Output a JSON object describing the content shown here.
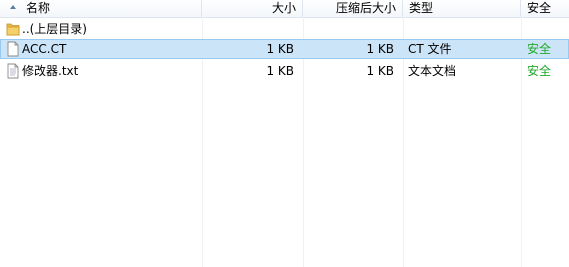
{
  "columns": {
    "name": "名称",
    "size": "大小",
    "compressed_size": "压缩后大小",
    "type": "类型",
    "security": "安全"
  },
  "rows": [
    {
      "name": "..(上层目录)",
      "icon": "folder-icon",
      "size": "",
      "compressed_size": "",
      "type": "",
      "security": ""
    },
    {
      "name": "ACC.CT",
      "icon": "file-icon",
      "size": "1 KB",
      "compressed_size": "1 KB",
      "type": "CT 文件",
      "security": "安全"
    },
    {
      "name": "修改器.txt",
      "icon": "text-file-icon",
      "size": "1 KB",
      "compressed_size": "1 KB",
      "type": "文本文档",
      "security": "安全"
    }
  ],
  "colors": {
    "selected_row": "#cce4f7",
    "safe_text": "#22a82a"
  }
}
